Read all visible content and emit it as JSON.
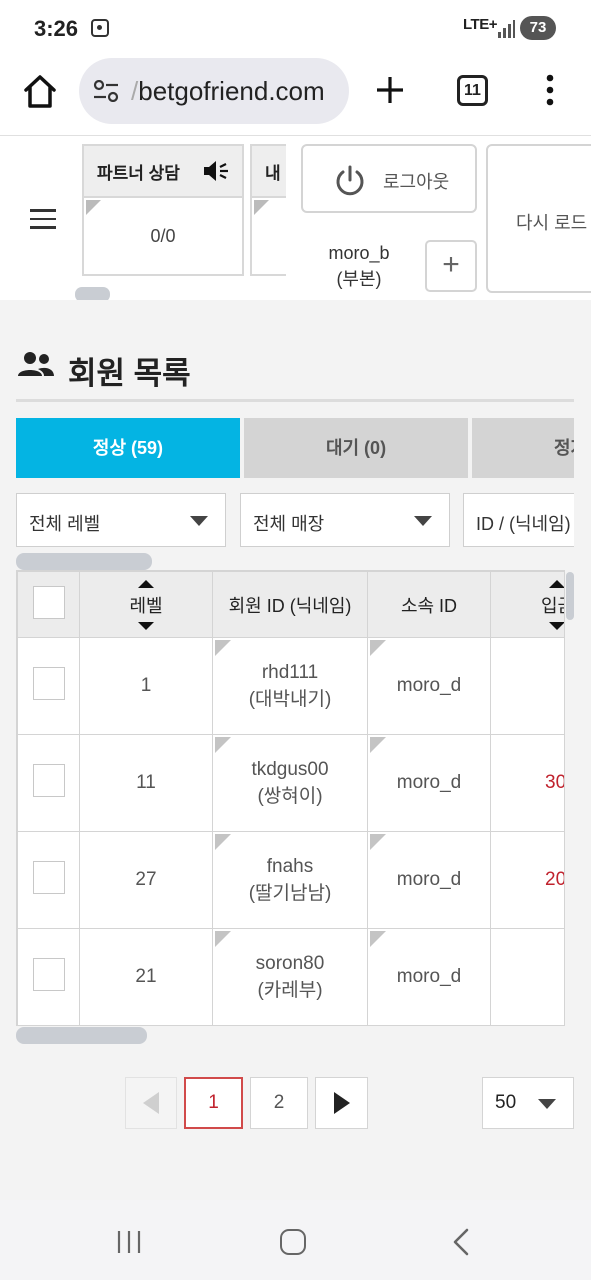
{
  "status_bar": {
    "time": "3:26",
    "network": "LTE+",
    "battery": "73",
    "icons": [
      "screenshot-icon",
      "signal-icon",
      "battery-icon"
    ]
  },
  "browser": {
    "url_prefix": "/",
    "url": "betgofriend.com",
    "tab_count": "11",
    "icons": [
      "home-icon",
      "site-settings-icon",
      "new-tab-icon",
      "tabs-icon",
      "more-menu-icon"
    ]
  },
  "header": {
    "partner_card": {
      "title": "파트너 상담",
      "value": "0/0"
    },
    "second_card": {
      "title": "내"
    },
    "logout_label": "로그아웃",
    "user_name": "moro_b",
    "user_role": "(부본)",
    "add_label": "+",
    "reload_label": "다시 로드"
  },
  "section": {
    "title": "회원 목록"
  },
  "tabs": [
    {
      "label": "정상 (59)",
      "active": true
    },
    {
      "label": "대기 (0)",
      "active": false
    },
    {
      "label": "정지",
      "active": false
    }
  ],
  "filters": {
    "level": "전체 레벨",
    "store": "전체 매장",
    "search": "ID / (닉네임)"
  },
  "table": {
    "headers": [
      "레벨",
      "회원 ID (닉네임)",
      "소속 ID",
      "입금"
    ],
    "rows": [
      {
        "level": "1",
        "member_id": "rhd111",
        "nickname": "(대박내기)",
        "parent_id": "moro_d",
        "deposit": ""
      },
      {
        "level": "11",
        "member_id": "tkdgus00",
        "nickname": "(쌍혀이)",
        "parent_id": "moro_d",
        "deposit": "30"
      },
      {
        "level": "27",
        "member_id": "fnahs",
        "nickname": "(딸기남남)",
        "parent_id": "moro_d",
        "deposit": "20"
      },
      {
        "level": "21",
        "member_id": "soron80",
        "nickname": "(카레부)",
        "parent_id": "moro_d",
        "deposit": ""
      }
    ]
  },
  "pagination": {
    "pages": [
      "1",
      "2"
    ],
    "current": "1",
    "per_page": "50"
  },
  "colors": {
    "accent": "#04b4e3",
    "deposit_red": "#c0222d",
    "current_page_border": "#d14a4a"
  }
}
